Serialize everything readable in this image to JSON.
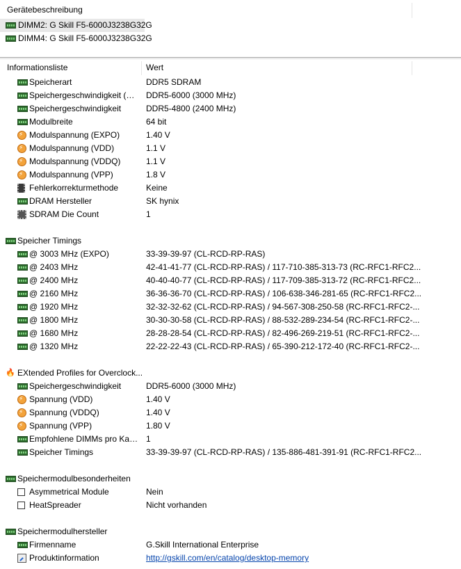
{
  "device_panel": {
    "header": "Gerätebeschreibung",
    "devices": [
      {
        "label": "DIMM2: G Skill F5-6000J3238G32G",
        "icon": "ram-module-icon",
        "selected": true
      },
      {
        "label": "DIMM4: G Skill F5-6000J3238G32G",
        "icon": "ram-module-icon",
        "selected": false
      }
    ]
  },
  "info_panel": {
    "col_field": "Informationsliste",
    "col_value": "Wert",
    "rows": [
      {
        "level": 1,
        "icon": "ram",
        "label": "Speicherart",
        "value": "DDR5 SDRAM"
      },
      {
        "level": 1,
        "icon": "ram",
        "label": "Speichergeschwindigkeit (EX...",
        "value": "DDR5-6000 (3000 MHz)"
      },
      {
        "level": 1,
        "icon": "ram",
        "label": "Speichergeschwindigkeit",
        "value": "DDR5-4800 (2400 MHz)"
      },
      {
        "level": 1,
        "icon": "ram",
        "label": "Modulbreite",
        "value": "64 bit"
      },
      {
        "level": 1,
        "icon": "volt",
        "label": "Modulspannung (EXPO)",
        "value": "1.40 V"
      },
      {
        "level": 1,
        "icon": "volt",
        "label": "Modulspannung (VDD)",
        "value": "1.1 V"
      },
      {
        "level": 1,
        "icon": "volt",
        "label": "Modulspannung (VDDQ)",
        "value": "1.1 V"
      },
      {
        "level": 1,
        "icon": "volt",
        "label": "Modulspannung (VPP)",
        "value": "1.8 V"
      },
      {
        "level": 1,
        "icon": "chip",
        "label": "Fehlerkorrekturmethode",
        "value": "Keine"
      },
      {
        "level": 1,
        "icon": "ram",
        "label": "DRAM Hersteller",
        "value": "SK hynix"
      },
      {
        "level": 1,
        "icon": "dram",
        "label": "SDRAM Die Count",
        "value": "1"
      },
      {
        "level": 0,
        "icon": "",
        "label": "",
        "value": ""
      },
      {
        "level": 0,
        "icon": "ram",
        "label": "Speicher Timings",
        "value": ""
      },
      {
        "level": 1,
        "icon": "ram",
        "label": "@ 3003 MHz (EXPO)",
        "value": "33-39-39-97  (CL-RCD-RP-RAS)"
      },
      {
        "level": 1,
        "icon": "ram",
        "label": "@ 2403 MHz",
        "value": "42-41-41-77  (CL-RCD-RP-RAS) / 117-710-385-313-73  (RC-RFC1-RFC2..."
      },
      {
        "level": 1,
        "icon": "ram",
        "label": "@ 2400 MHz",
        "value": "40-40-40-77  (CL-RCD-RP-RAS) / 117-709-385-313-72  (RC-RFC1-RFC2..."
      },
      {
        "level": 1,
        "icon": "ram",
        "label": "@ 2160 MHz",
        "value": "36-36-36-70  (CL-RCD-RP-RAS) / 106-638-346-281-65  (RC-RFC1-RFC2..."
      },
      {
        "level": 1,
        "icon": "ram",
        "label": "@ 1920 MHz",
        "value": "32-32-32-62  (CL-RCD-RP-RAS) / 94-567-308-250-58  (RC-RFC1-RFC2-..."
      },
      {
        "level": 1,
        "icon": "ram",
        "label": "@ 1800 MHz",
        "value": "30-30-30-58  (CL-RCD-RP-RAS) / 88-532-289-234-54  (RC-RFC1-RFC2-..."
      },
      {
        "level": 1,
        "icon": "ram",
        "label": "@ 1680 MHz",
        "value": "28-28-28-54  (CL-RCD-RP-RAS) / 82-496-269-219-51  (RC-RFC1-RFC2-..."
      },
      {
        "level": 1,
        "icon": "ram",
        "label": "@ 1320 MHz",
        "value": "22-22-22-43  (CL-RCD-RP-RAS) / 65-390-212-172-40  (RC-RFC1-RFC2-..."
      },
      {
        "level": 0,
        "icon": "",
        "label": "",
        "value": ""
      },
      {
        "level": 0,
        "icon": "fire",
        "label": "EXtended Profiles for Overclock...",
        "value": ""
      },
      {
        "level": 1,
        "icon": "ram",
        "label": "Speichergeschwindigkeit",
        "value": "DDR5-6000 (3000 MHz)"
      },
      {
        "level": 1,
        "icon": "volt",
        "label": "Spannung (VDD)",
        "value": "1.40 V"
      },
      {
        "level": 1,
        "icon": "volt",
        "label": "Spannung (VDDQ)",
        "value": "1.40 V"
      },
      {
        "level": 1,
        "icon": "volt",
        "label": "Spannung (VPP)",
        "value": "1.80 V"
      },
      {
        "level": 1,
        "icon": "ram",
        "label": "Empfohlene DIMMs pro Kanal",
        "value": "1"
      },
      {
        "level": 1,
        "icon": "ram",
        "label": "Speicher Timings",
        "value": "33-39-39-97  (CL-RCD-RP-RAS) / 135-886-481-391-91  (RC-RFC1-RFC2..."
      },
      {
        "level": 0,
        "icon": "",
        "label": "",
        "value": ""
      },
      {
        "level": 0,
        "icon": "ram",
        "label": "Speichermodulbesonderheiten",
        "value": ""
      },
      {
        "level": 1,
        "icon": "checkbox",
        "label": "Asymmetrical Module",
        "value": "Nein"
      },
      {
        "level": 1,
        "icon": "checkbox",
        "label": "HeatSpreader",
        "value": "Nicht vorhanden"
      },
      {
        "level": 0,
        "icon": "",
        "label": "",
        "value": ""
      },
      {
        "level": 0,
        "icon": "ram",
        "label": "Speichermodulhersteller",
        "value": ""
      },
      {
        "level": 1,
        "icon": "ram",
        "label": "Firmenname",
        "value": "G.Skill International Enterprise"
      },
      {
        "level": 1,
        "icon": "link",
        "label": "Produktinformation",
        "value": "http://gskill.com/en/catalog/desktop-memory",
        "is_link": true
      }
    ]
  }
}
